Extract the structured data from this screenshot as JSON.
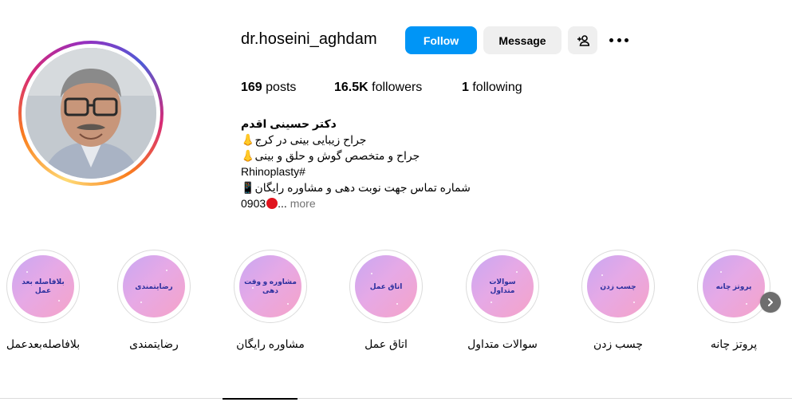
{
  "profile": {
    "username": "dr.hoseini_aghdam",
    "follow_label": "Follow",
    "message_label": "Message"
  },
  "stats": {
    "posts_count": "169",
    "posts_label": "posts",
    "followers_count": "16.5K",
    "followers_label": "followers",
    "following_count": "1",
    "following_label": "following"
  },
  "bio": {
    "name": "دکتر حسینی اقدم",
    "line1": "جراح زیبایی بینی در کرج",
    "line2": "جراح و متخصص گوش و حلق و بینی",
    "line3": "Rhinoplasty#",
    "line4": "شماره تماس جهت نوبت دهی و مشاوره رایگان",
    "line5_prefix": "0903",
    "line5_ellipsis": "...",
    "more_label": "more",
    "nose_emoji": "nose",
    "phone_emoji": "mobile-phone",
    "red_emoji": "red-circle"
  },
  "highlights": [
    {
      "cover_text": "بلافاصله بعد عمل",
      "label": "بلافاصله‌بعدعمل"
    },
    {
      "cover_text": "رضایتمندی",
      "label": "رضایتمندی"
    },
    {
      "cover_text": "مشاوره و وقت دهی",
      "label": "مشاوره رایگان"
    },
    {
      "cover_text": "اتاق عمل",
      "label": "اتاق عمل"
    },
    {
      "cover_text": "سوالات متداول",
      "label": "سوالات متداول"
    },
    {
      "cover_text": "چسب زدن",
      "label": "چسب زدن"
    },
    {
      "cover_text": "پروتز چانه",
      "label": "پروتز چانه"
    }
  ],
  "colors": {
    "follow_button": "#0095f6",
    "secondary_button": "#efefef",
    "highlight_gradient_start": "#c9a7f2",
    "highlight_gradient_end": "#f5a3c8",
    "highlight_text": "#2b2f9e",
    "muted_text": "#737373"
  }
}
